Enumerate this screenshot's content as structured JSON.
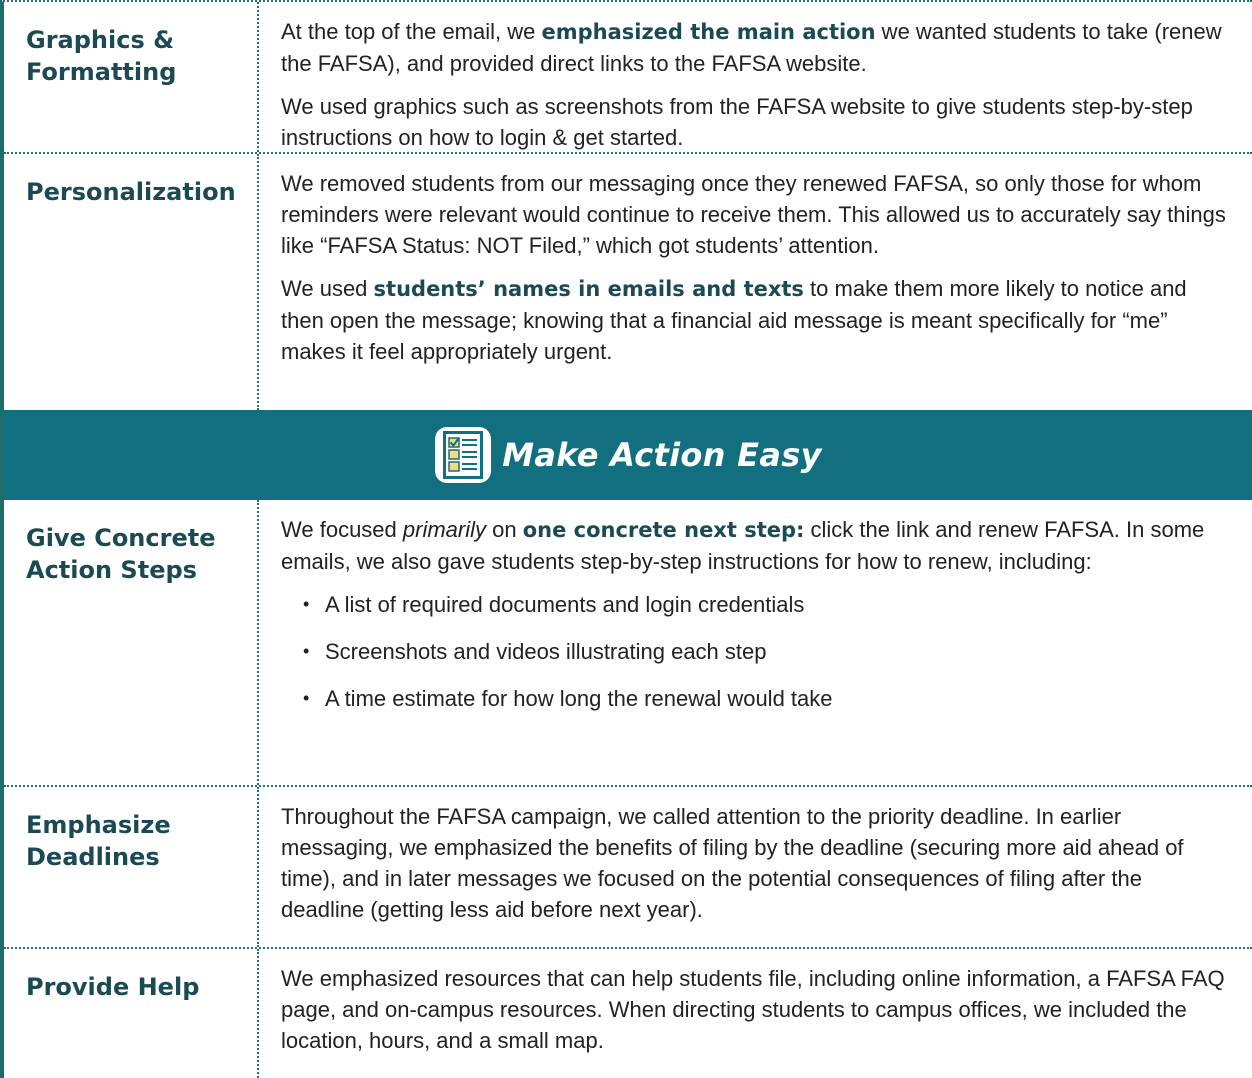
{
  "rows_top": [
    {
      "label_lines": [
        "Graphics &",
        "Formatting"
      ],
      "paragraphs": [
        [
          {
            "t": "At the top of the email, we "
          },
          {
            "t": "emphasized the main action",
            "b": true
          },
          {
            "t": " we wanted students to take (renew the FAFSA), and provided direct links to the FAFSA website."
          }
        ],
        [
          {
            "t": "We used graphics such as screenshots from the FAFSA website to give students step-by-step instructions on how to login & get started."
          }
        ]
      ]
    },
    {
      "label_lines": [
        "Personalization"
      ],
      "paragraphs": [
        [
          {
            "t": "We removed students from our messaging once they renewed FAFSA, so only those for whom reminders were relevant would continue to receive them. This allowed us to accurately say things like “FAFSA Status: NOT Filed,” which got students’ attention."
          }
        ],
        [
          {
            "t": "We used "
          },
          {
            "t": "students’ names in emails and texts",
            "b": true
          },
          {
            "t": " to make them more likely to notice and then open the message; knowing that a financial aid message is meant specifically for “me” makes it feel appropriately urgent."
          }
        ]
      ]
    }
  ],
  "banner": {
    "title": "Make Action Easy",
    "icon": "checklist-icon",
    "color": "#126f80"
  },
  "rows_bottom": [
    {
      "label_lines": [
        "Give Concrete",
        "Action Steps"
      ],
      "paragraphs": [
        [
          {
            "t": "We focused "
          },
          {
            "t": "primarily",
            "i": true
          },
          {
            "t": " on "
          },
          {
            "t": "one concrete next step:",
            "b": true
          },
          {
            "t": " click the link and renew FAFSA. In some emails, we also gave students step-by-step instructions for how to renew, including:"
          }
        ]
      ],
      "bullets": [
        "A list of required documents and login credentials",
        "Screenshots and videos illustrating each step",
        "A time estimate for how long the renewal would take"
      ]
    },
    {
      "label_lines": [
        "Emphasize",
        "Deadlines"
      ],
      "paragraphs": [
        [
          {
            "t": "Throughout the FAFSA campaign, we called attention to the priority deadline. In earlier messaging, we emphasized the benefits of filing by the deadline (securing more aid ahead of time), and in later messages we focused on the potential consequences of filing after the deadline (getting less aid before next year)."
          }
        ]
      ]
    },
    {
      "label_lines": [
        "Provide Help"
      ],
      "paragraphs": [
        [
          {
            "t": "We emphasized resources that can help students file, including online information, a FAFSA FAQ page, and on-campus resources. When directing students to campus offices, we included the location, hours, and a small map."
          }
        ]
      ]
    }
  ],
  "colors": {
    "heading": "#1b4a55",
    "banner": "#126f80",
    "border": "#1c6e82",
    "left_rule": "#1b6e69"
  }
}
